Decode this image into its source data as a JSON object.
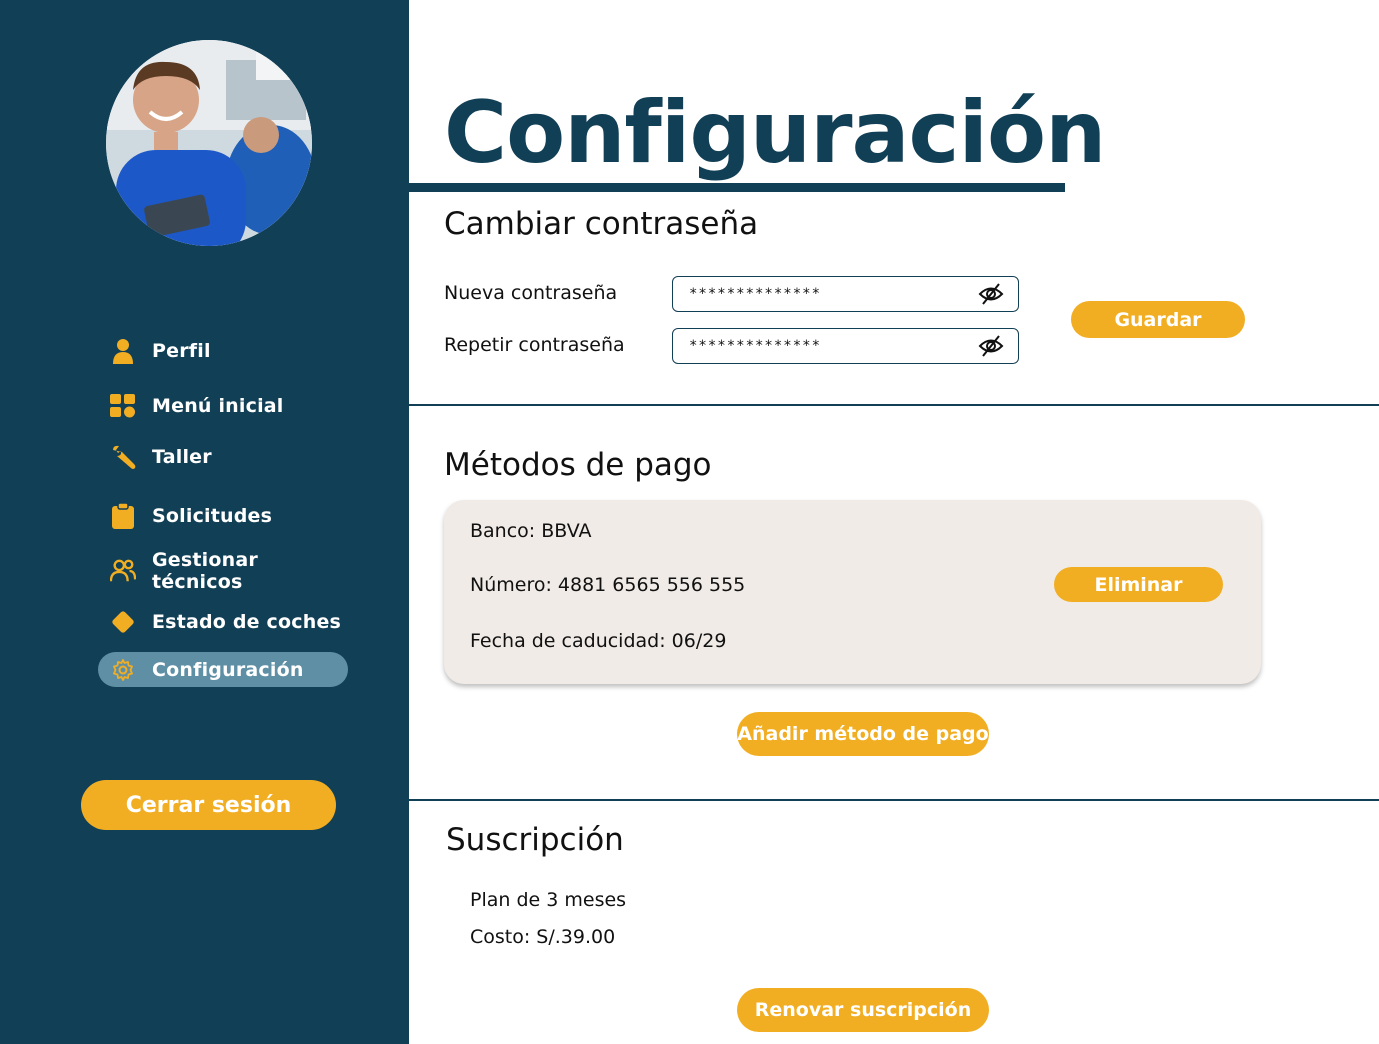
{
  "sidebar": {
    "nav": [
      {
        "label": "Perfil",
        "icon": "user-icon"
      },
      {
        "label": "Menú inicial",
        "icon": "grid-icon"
      },
      {
        "label": "Taller",
        "icon": "wrench-icon"
      },
      {
        "label": "Solicitudes",
        "icon": "clipboard-icon"
      },
      {
        "label": "Gestionar técnicos",
        "icon": "users-icon"
      },
      {
        "label": "Estado de coches",
        "icon": "diamond-icon"
      },
      {
        "label": "Configuración",
        "icon": "gear-icon",
        "active": true
      }
    ],
    "logout_label": "Cerrar sesión"
  },
  "page": {
    "title": "Configuración"
  },
  "password": {
    "title": "Cambiar contraseña",
    "new_label": "Nueva contraseña",
    "new_value": "**************",
    "repeat_label": "Repetir contraseña",
    "repeat_value": "**************",
    "save_label": "Guardar"
  },
  "payment": {
    "title": "Métodos de pago",
    "bank": "Banco: BBVA",
    "number": "Número: 4881 6565 556 555",
    "expiry": "Fecha de caducidad: 06/29",
    "delete_label": "Eliminar",
    "add_label": "Añadir método de pago"
  },
  "subscription": {
    "title": "Suscripción",
    "plan": "Plan de 3 meses",
    "cost": "Costo: S/.39.00",
    "renew_label": "Renovar suscripción"
  },
  "colors": {
    "sidebar_bg": "#113f56",
    "accent": "#f2ae23",
    "active_item": "#5f8fa5",
    "card_bg": "#f0ebe7"
  }
}
